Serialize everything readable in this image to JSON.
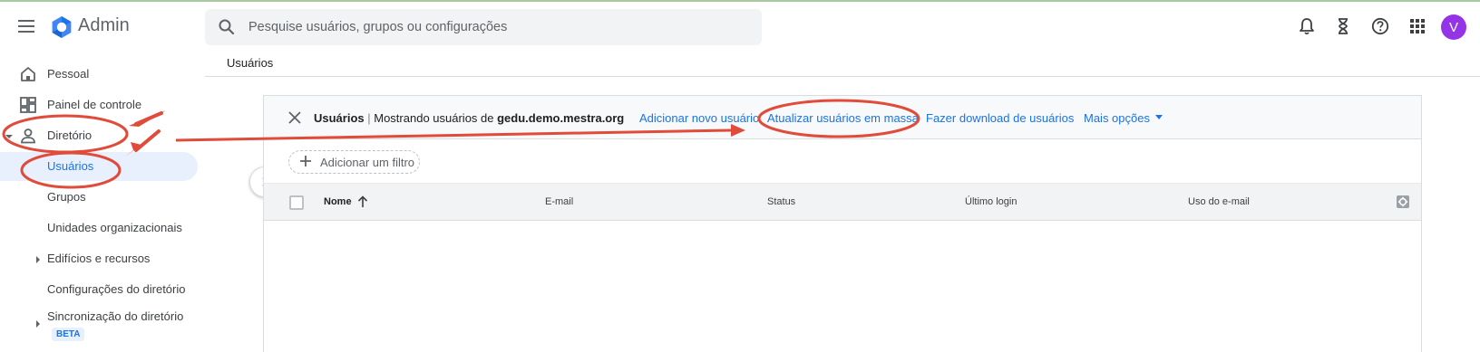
{
  "header": {
    "app_name": "Admin",
    "search_placeholder": "Pesquise usuários, grupos ou configurações",
    "avatar_letter": "V",
    "icons": [
      "menu-icon",
      "admin-logo",
      "search-icon",
      "bell-icon",
      "hourglass-icon",
      "help-icon",
      "apps-icon"
    ]
  },
  "breadcrumb": {
    "current": "Usuários"
  },
  "sidebar": {
    "items": [
      {
        "label": "Pessoal",
        "icon": "home-icon"
      },
      {
        "label": "Painel de controle",
        "icon": "dashboard-icon"
      },
      {
        "label": "Diretório",
        "icon": "person-icon",
        "expanded": true
      },
      {
        "label": "Usuários",
        "active": true
      },
      {
        "label": "Grupos"
      },
      {
        "label": "Unidades organizacionais"
      },
      {
        "label": "Edifícios e recursos",
        "collapsible": true
      },
      {
        "label": "Configurações do diretório"
      },
      {
        "label": "Sincronização do diretório",
        "collapsible": true,
        "badge": "BETA"
      }
    ]
  },
  "panel": {
    "title": "Usuários",
    "separator": " | ",
    "subtitle": "Mostrando usuários de ",
    "domain": "gedu.demo.mestra.org",
    "actions": {
      "add_user": "Adicionar novo usuário",
      "bulk_update": "Atualizar usuários em massa",
      "download": "Fazer download de usuários",
      "more": "Mais opções"
    },
    "filter_label": "Adicionar um filtro",
    "columns": [
      "Nome",
      "E-mail",
      "Status",
      "Último login",
      "Uso do e-mail"
    ]
  },
  "colors": {
    "accent": "#1a73e8",
    "annotation": "#e04b3a",
    "avatar": "#9334e6",
    "active_bg": "#e8f0fe"
  }
}
